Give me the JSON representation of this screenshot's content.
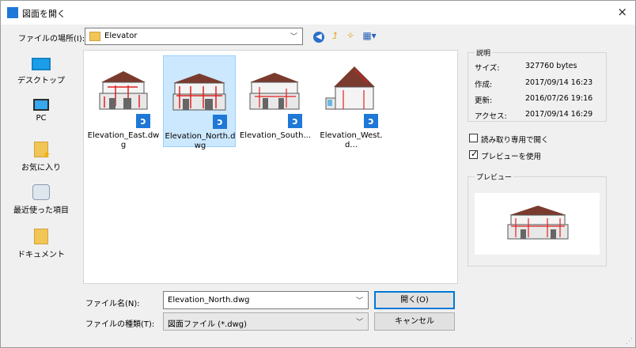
{
  "window": {
    "title": "図面を開く",
    "close_glyph": "×"
  },
  "location": {
    "label": "ファイルの場所(I):",
    "value": "Elevator"
  },
  "toolbar": {
    "back_glyph": "◀",
    "up_glyph": "⮥",
    "new_folder_glyph": "✧",
    "view_glyph": "▦▾"
  },
  "places": [
    {
      "label": "デスクトップ",
      "icon": "desktop-icon"
    },
    {
      "label": "PC",
      "icon": "pc-icon"
    },
    {
      "label": "お気に入り",
      "icon": "favorites-icon"
    },
    {
      "label": "最近使った項目",
      "icon": "recent-items-icon"
    },
    {
      "label": "ドキュメント",
      "icon": "documents-icon"
    }
  ],
  "files": [
    {
      "name": "Elevation_East.dwg",
      "selected": false
    },
    {
      "name": "Elevation_North.dwg",
      "selected": true
    },
    {
      "name": "Elevation_South...",
      "selected": false
    },
    {
      "name": "Elevation_West.d...",
      "selected": false
    }
  ],
  "info": {
    "title": "説明",
    "rows": [
      {
        "key": "サイズ:",
        "value": "327760 bytes"
      },
      {
        "key": "作成:",
        "value": "2017/09/14 16:23"
      },
      {
        "key": "更新:",
        "value": "2016/07/26 19:16"
      },
      {
        "key": "アクセス:",
        "value": "2017/09/14 16:29"
      }
    ]
  },
  "options": {
    "readonly": {
      "label": "読み取り専用で開く",
      "checked": false
    },
    "use_preview": {
      "label": "プレビューを使用",
      "checked": true
    }
  },
  "preview": {
    "title": "プレビュー"
  },
  "filename": {
    "label": "ファイル名(N):",
    "value": "Elevation_North.dwg"
  },
  "filetype": {
    "label": "ファイルの種類(T):",
    "value": "図面ファイル (*.dwg)"
  },
  "buttons": {
    "open": "開く(O)",
    "cancel": "キャンセル"
  },
  "badge_glyph": "ↄ",
  "colors": {
    "accent": "#0078d7",
    "selection": "#cce8ff",
    "drawing_red": "#e02020",
    "roof": "#7a3b2e"
  }
}
